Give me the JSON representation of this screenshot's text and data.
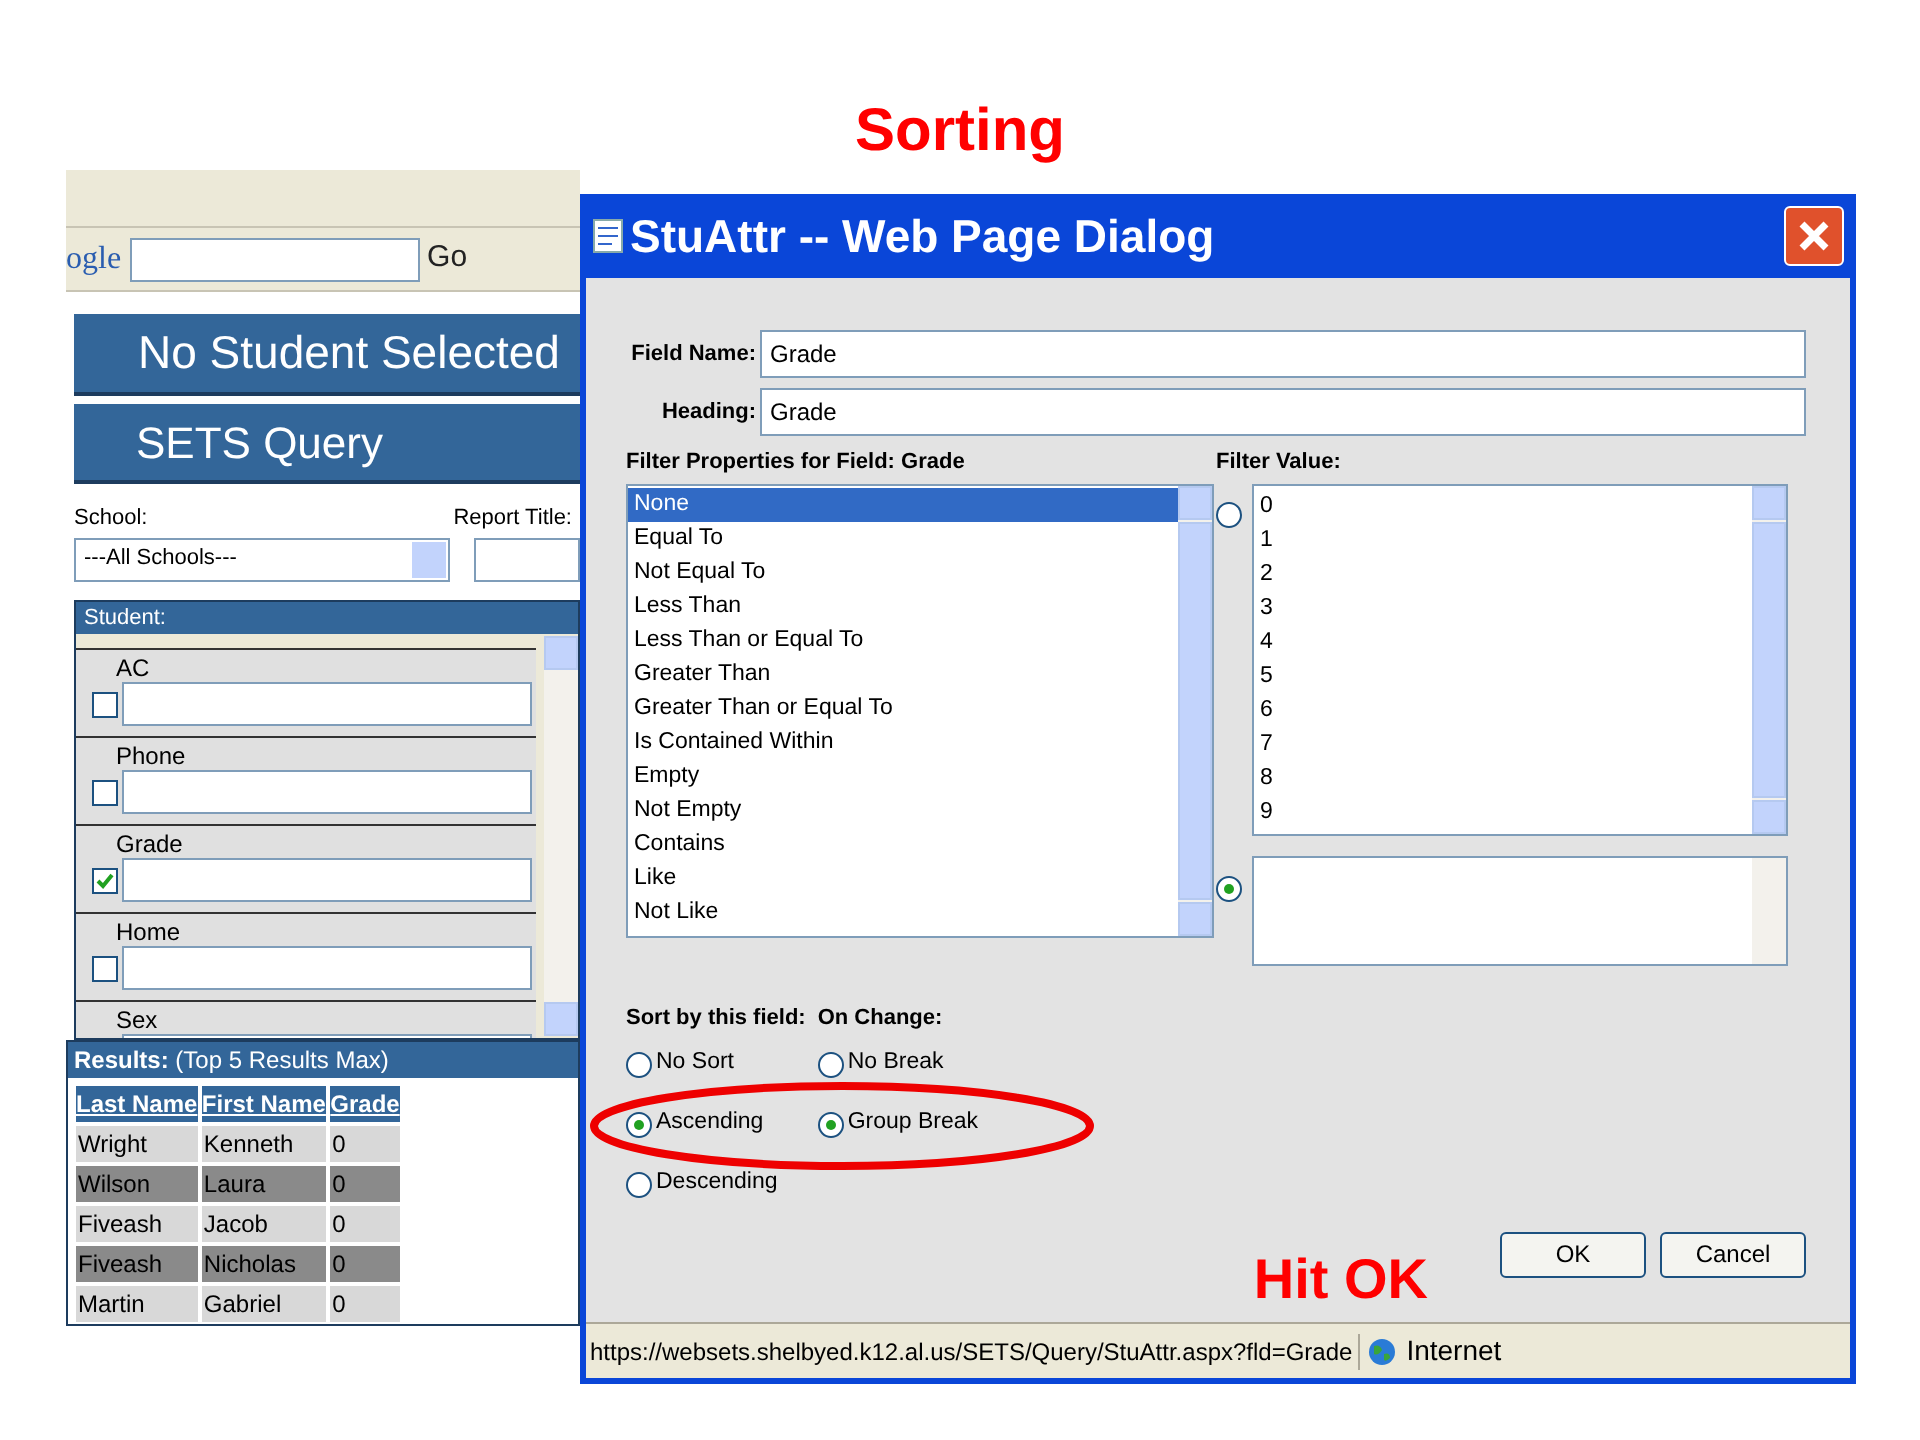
{
  "slide_title": "Sorting",
  "browser": {
    "search_logo": "ogle",
    "go": "Go"
  },
  "page": {
    "banner": "No Student Selected",
    "section": "SETS Query",
    "school_label": "School:",
    "school_value": "---All Schools---",
    "report_title_label": "Report Title:",
    "student_header": "Student:",
    "fields": [
      {
        "label": "AC",
        "checked": false
      },
      {
        "label": "Phone",
        "checked": false
      },
      {
        "label": "Grade",
        "checked": true
      },
      {
        "label": "Home",
        "checked": false
      },
      {
        "label": "Sex"
      }
    ],
    "results": {
      "title": "**Results:** (Top 5 Results Max)",
      "columns": [
        "Last Name",
        "First Name",
        "Grade"
      ],
      "rows": [
        [
          "Wright",
          "Kenneth",
          "0"
        ],
        [
          "Wilson",
          "Laura",
          "0"
        ],
        [
          "Fiveash",
          "Jacob",
          "0"
        ],
        [
          "Fiveash",
          "Nicholas",
          "0"
        ],
        [
          "Martin",
          "Gabriel",
          "0"
        ]
      ]
    }
  },
  "dialog": {
    "title": "StuAttr -- Web Page Dialog",
    "field_name": {
      "label": "Field Name:",
      "value": "Grade"
    },
    "heading": {
      "label": "Heading:",
      "value": "Grade"
    },
    "filter_properties": {
      "label": "Filter Properties for Field: Grade",
      "options": [
        {
          "label": "None",
          "selected": true
        },
        {
          "label": "Equal To",
          "selected": false
        },
        {
          "label": "Not Equal To",
          "selected": false
        },
        {
          "label": "Less Than",
          "selected": false
        },
        {
          "label": "Less Than or Equal To",
          "selected": false
        },
        {
          "label": "Greater Than",
          "selected": false
        },
        {
          "label": "Greater Than or Equal To",
          "selected": false
        },
        {
          "label": "Is Contained Within",
          "selected": false
        },
        {
          "label": "Empty",
          "selected": false
        },
        {
          "label": "Not Empty",
          "selected": false
        },
        {
          "label": "Contains",
          "selected": false
        },
        {
          "label": "Like",
          "selected": false
        },
        {
          "label": "Not Like",
          "selected": false
        }
      ]
    },
    "filter_value": {
      "label": "Filter Value:",
      "list_selected": false,
      "values": [
        "0",
        "1",
        "2",
        "3",
        "4",
        "5",
        "6",
        "7",
        "8",
        "9"
      ],
      "custom_selected": true
    },
    "sort": {
      "label": "Sort by this field:",
      "options": [
        {
          "label": "No Sort",
          "selected": false
        },
        {
          "label": "Ascending",
          "selected": true
        },
        {
          "label": "Descending",
          "selected": false
        }
      ]
    },
    "on_change": {
      "label": "On Change:",
      "options": [
        {
          "label": "No Break",
          "selected": false
        },
        {
          "label": "Group Break",
          "selected": true
        }
      ]
    },
    "buttons": [
      "OK",
      "Cancel"
    ],
    "status": {
      "url": "https://websets.shelbyed.k12.al.us/SETS/Query/StuAttr.aspx?fld=Grade",
      "zone": "Internet"
    }
  },
  "note": "Hit OK"
}
